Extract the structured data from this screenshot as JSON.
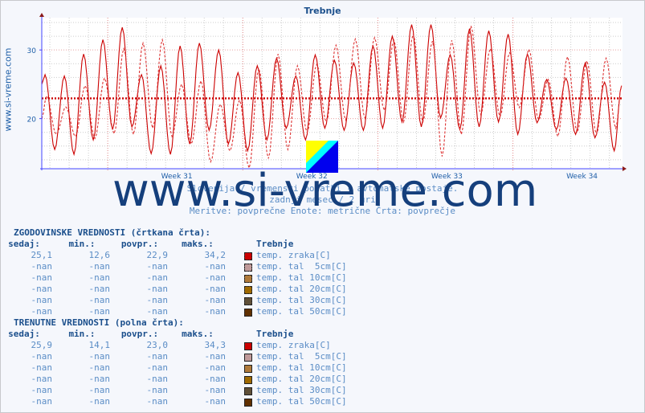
{
  "title": "Trebnje",
  "side_text": "www.si-vreme.com",
  "watermark": "www.si-vreme.com",
  "subtitle_lines": [
    "Slovenija / vremenski podatki - avtomatske postaje.",
    "zadnji mesec / 2 uri",
    "Meritve: povprečne  Enote: metrične  Črta: povprečje"
  ],
  "chart_data": {
    "type": "line",
    "title": "Trebnje",
    "x_unit": "days",
    "xlim": [
      0,
      30.1
    ],
    "ylim": [
      12.7,
      34.0
    ],
    "y_ticks": [
      20,
      30
    ],
    "x_ticks": [
      {
        "x": 7,
        "label": "Week 31"
      },
      {
        "x": 14,
        "label": "Week 32"
      },
      {
        "x": 21,
        "label": "Week 33"
      },
      {
        "x": 28,
        "label": "Week 34"
      }
    ],
    "grid": true,
    "series": [
      {
        "name": "temp. zraka[C] (trenutne)",
        "style": "solid",
        "color": "#cc0000",
        "start": 25.0,
        "end": 24.8,
        "daily_max": [
          26.4,
          26.2,
          29.4,
          31.5,
          33.3,
          26.4,
          27.7,
          30.6,
          31.0,
          30.0,
          26.7,
          27.7,
          28.8,
          26.2,
          29.3,
          28.5,
          28.1,
          30.6,
          32.0,
          33.7,
          33.7,
          29.3,
          33.1,
          32.8,
          32.3,
          29.4,
          25.7,
          25.9,
          28.1,
          25.3
        ],
        "daily_min": [
          15.5,
          14.8,
          16.9,
          18.4,
          18.8,
          14.9,
          14.8,
          16.3,
          18.3,
          16.3,
          15.3,
          16.9,
          18.6,
          16.9,
          18.6,
          18.3,
          18.3,
          18.6,
          19.5,
          18.8,
          20.1,
          18.4,
          18.8,
          19.5,
          17.7,
          19.4,
          18.4,
          17.7,
          17.2,
          15.3
        ],
        "average": 23.0
      },
      {
        "name": "temp. zraka[C] (zgodovinske)",
        "style": "dashed",
        "color": "#dd3333",
        "start": 20.0,
        "end": 24.8,
        "daily_max": [
          23.3,
          21.7,
          24.8,
          25.9,
          30.2,
          31.0,
          31.5,
          25.0,
          25.5,
          22.1,
          22.7,
          27.3,
          29.4,
          27.7,
          27.9,
          30.7,
          31.6,
          31.8,
          31.4,
          32.3,
          31.3,
          31.4,
          33.5,
          30.2,
          29.6,
          30.1,
          25.7,
          29.0,
          28.4,
          28.8
        ],
        "daily_min": [
          17.7,
          17.4,
          17.1,
          17.8,
          17.7,
          18.6,
          17.4,
          16.3,
          13.7,
          15.3,
          12.8,
          14.2,
          15.5,
          18.0,
          19.5,
          19.8,
          20.1,
          21.2,
          19.5,
          19.5,
          14.5,
          17.7,
          20.6,
          20.3,
          21.6,
          19.8,
          17.4,
          18.0,
          17.7,
          18.6
        ],
        "average": 22.9
      }
    ]
  },
  "historic": {
    "heading": "ZGODOVINSKE VREDNOSTI (črtkana črta):",
    "cols": [
      "sedaj:",
      "min.:",
      "povpr.:",
      "maks.:",
      "Trebnje"
    ],
    "rows": [
      {
        "v": [
          "25,1",
          "12,6",
          "22,9",
          "34,2"
        ],
        "label": "temp. zraka[C]",
        "color": "#cc0000"
      },
      {
        "v": [
          "-nan",
          "-nan",
          "-nan",
          "-nan"
        ],
        "label": "temp. tal  5cm[C]",
        "color": "#c09a9a"
      },
      {
        "v": [
          "-nan",
          "-nan",
          "-nan",
          "-nan"
        ],
        "label": "temp. tal 10cm[C]",
        "color": "#b07a3a"
      },
      {
        "v": [
          "-nan",
          "-nan",
          "-nan",
          "-nan"
        ],
        "label": "temp. tal 20cm[C]",
        "color": "#a06a00"
      },
      {
        "v": [
          "-nan",
          "-nan",
          "-nan",
          "-nan"
        ],
        "label": "temp. tal 30cm[C]",
        "color": "#605038"
      },
      {
        "v": [
          "-nan",
          "-nan",
          "-nan",
          "-nan"
        ],
        "label": "temp. tal 50cm[C]",
        "color": "#603000"
      }
    ]
  },
  "current": {
    "heading": "TRENUTNE VREDNOSTI (polna črta):",
    "cols": [
      "sedaj:",
      "min.:",
      "povpr.:",
      "maks.:",
      "Trebnje"
    ],
    "rows": [
      {
        "v": [
          "25,9",
          "14,1",
          "23,0",
          "34,3"
        ],
        "label": "temp. zraka[C]",
        "color": "#cc0000"
      },
      {
        "v": [
          "-nan",
          "-nan",
          "-nan",
          "-nan"
        ],
        "label": "temp. tal  5cm[C]",
        "color": "#c09a9a"
      },
      {
        "v": [
          "-nan",
          "-nan",
          "-nan",
          "-nan"
        ],
        "label": "temp. tal 10cm[C]",
        "color": "#b07a3a"
      },
      {
        "v": [
          "-nan",
          "-nan",
          "-nan",
          "-nan"
        ],
        "label": "temp. tal 20cm[C]",
        "color": "#a06a00"
      },
      {
        "v": [
          "-nan",
          "-nan",
          "-nan",
          "-nan"
        ],
        "label": "temp. tal 30cm[C]",
        "color": "#605038"
      },
      {
        "v": [
          "-nan",
          "-nan",
          "-nan",
          "-nan"
        ],
        "label": "temp. tal 50cm[C]",
        "color": "#603000"
      }
    ]
  }
}
